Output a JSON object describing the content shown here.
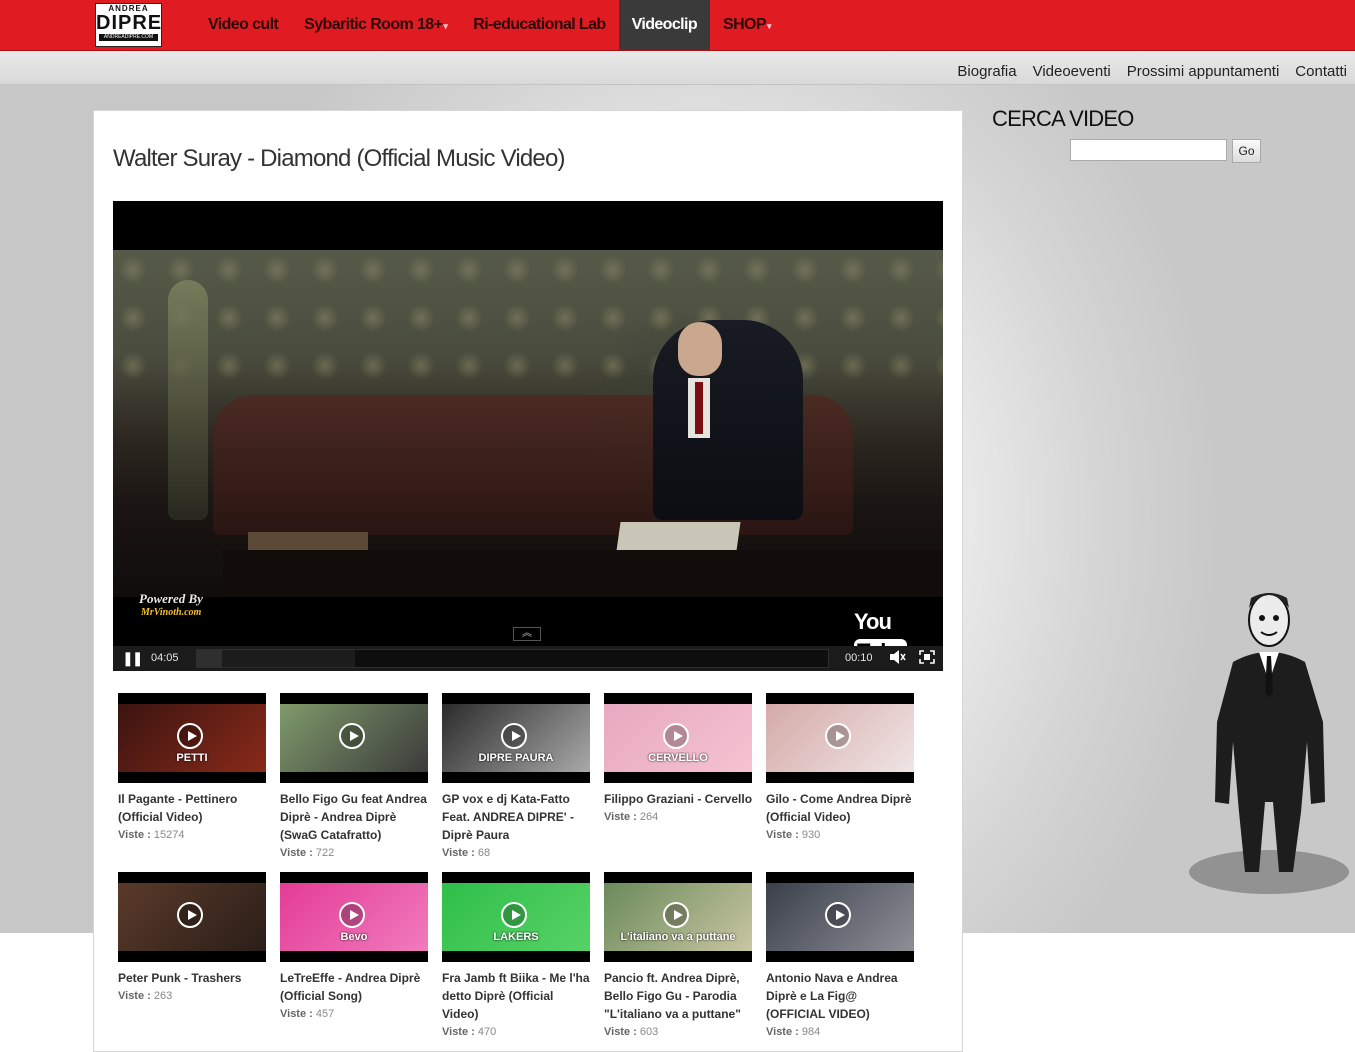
{
  "header": {
    "logo": {
      "line1": "ANDREA",
      "line2": "DIPRE",
      "line3": "ANDREADIPRE.COM"
    },
    "nav": [
      {
        "label": "Video cult",
        "dropdown": false,
        "active": false
      },
      {
        "label": "Sybaritic Room 18+",
        "dropdown": true,
        "active": false
      },
      {
        "label": "Ri-educational Lab",
        "dropdown": false,
        "active": false
      },
      {
        "label": "Videoclip",
        "dropdown": false,
        "active": true
      },
      {
        "label": "SHOP",
        "dropdown": true,
        "active": false
      }
    ]
  },
  "subnav": [
    "Biografia",
    "Videoeventi",
    "Prossimi appuntamenti",
    "Contatti"
  ],
  "main": {
    "title": "Walter Suray - Diamond (Official Music Video)",
    "player": {
      "watermark_line1": "Powered By",
      "watermark_line2": "MrVinoth.com",
      "brand_you": "You",
      "brand_tube": "Tube",
      "duration": "04:05",
      "current_time": "00:10",
      "progress_fraction": 0.04,
      "buffered_fraction": 0.25
    },
    "views_label": "Viste :",
    "videos": [
      {
        "title": "Il Pagante - Pettinero (Official Video)",
        "views": "15274",
        "colors": [
          "#3a1410",
          "#8a2a1a"
        ],
        "overlay": "PETTI"
      },
      {
        "title": "Bello Figo Gu feat Andrea Diprè - Andrea Diprè (SwaG Catafratto)",
        "views": "722",
        "colors": [
          "#7f9a6a",
          "#3b3b3b"
        ],
        "overlay": ""
      },
      {
        "title": "GP vox e dj Kata-Fatto Feat. ANDREA DIPRE' - Diprè Paura",
        "views": "68",
        "colors": [
          "#2b2b2b",
          "#a9a9a9"
        ],
        "overlay": "DIPRE PAURA"
      },
      {
        "title": "Filippo Graziani - Cervello",
        "views": "264",
        "colors": [
          "#e7a9bf",
          "#f5c3d2"
        ],
        "overlay": "CERVELLO"
      },
      {
        "title": "Gilo - Come Andrea Diprè (Official Video)",
        "views": "930",
        "colors": [
          "#d4aaa8",
          "#f0e5e5"
        ],
        "overlay": ""
      },
      {
        "title": "Peter Punk - Trashers",
        "views": "263",
        "colors": [
          "#5a3a2a",
          "#2a1e18"
        ],
        "overlay": ""
      },
      {
        "title": "LeTreEffe - Andrea Diprè (Official Song)",
        "views": "457",
        "colors": [
          "#e43c96",
          "#f07bbd"
        ],
        "overlay": "Bevo"
      },
      {
        "title": "Fra Jamb ft Biika - Me l'ha detto Diprè (Official Video)",
        "views": "470",
        "colors": [
          "#2fbf4a",
          "#57d266"
        ],
        "overlay": "LAKERS"
      },
      {
        "title": "Pancio ft. Andrea Diprè, Bello Figo Gu - Parodia \"L'italiano va a puttane\"",
        "views": "603",
        "colors": [
          "#6a8a5a",
          "#c9c6a3"
        ],
        "overlay": "L'italiano va a puttane"
      },
      {
        "title": "Antonio Nava e Andrea Diprè e La Fig@ (OFFICIAL VIDEO)",
        "views": "984",
        "colors": [
          "#3a3f4a",
          "#8d8f97"
        ],
        "overlay": ""
      }
    ]
  },
  "sidebar": {
    "search_title": "CERCA VIDEO",
    "search_value": "",
    "go_label": "Go"
  },
  "colors": {
    "brand_red": "#e11b22",
    "active_nav": "#3a3a3a"
  }
}
